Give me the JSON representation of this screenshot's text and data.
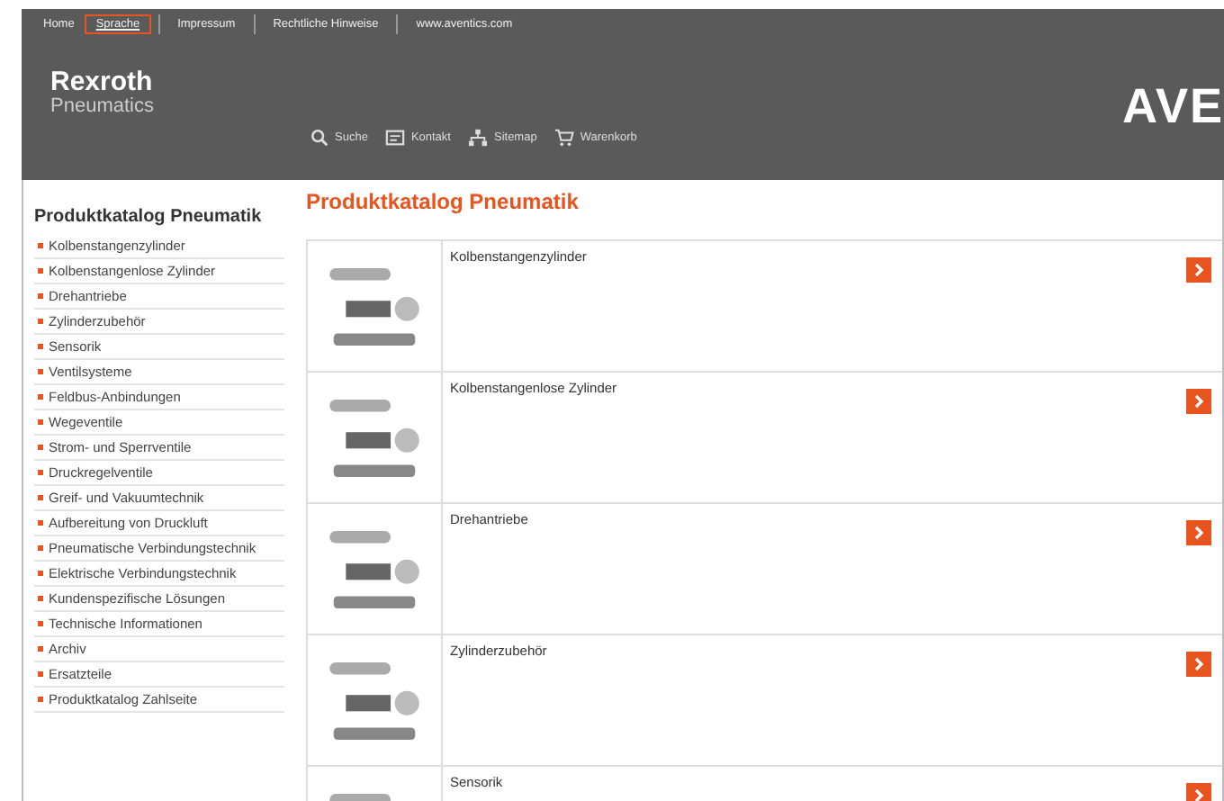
{
  "top_nav": [
    {
      "label": "Home",
      "selected": false
    },
    {
      "label": "Sprache",
      "selected": true
    },
    {
      "label": "Impressum",
      "selected": false
    },
    {
      "label": "Rechtliche Hinweise",
      "selected": false
    },
    {
      "label": "www.aventics.com",
      "selected": false
    }
  ],
  "brand": {
    "name": "Rexroth",
    "subtitle": "Pneumatics",
    "logo_partial": "AVE"
  },
  "tools": [
    {
      "kind": "search",
      "label": "Suche"
    },
    {
      "kind": "contact",
      "label": "Kontakt"
    },
    {
      "kind": "sitemap",
      "label": "Sitemap"
    },
    {
      "kind": "cart",
      "label": "Warenkorb"
    }
  ],
  "sidebar": {
    "title": "Produktkatalog Pneumatik",
    "items": [
      "Kolbenstangenzylinder",
      "Kolbenstangenlose Zylinder",
      "Drehantriebe",
      "Zylinderzubehör",
      "Sensorik",
      "Ventilsysteme",
      "Feldbus-Anbindungen",
      "Wegeventile",
      "Strom- und Sperrventile",
      "Druckregelventile",
      "Greif- und Vakuumtechnik",
      "Aufbereitung von Druckluft",
      "Pneumatische Verbindungstechnik",
      "Elektrische Verbindungstechnik",
      "Kundenspezifische Lösungen",
      "Technische Informationen",
      "Archiv",
      "Ersatzteile",
      "Produktkatalog Zahlseite"
    ]
  },
  "main": {
    "title": "Produktkatalog Pneumatik",
    "products": [
      "Kolbenstangenzylinder",
      "Kolbenstangenlose Zylinder",
      "Drehantriebe",
      "Zylinderzubehör",
      "Sensorik"
    ]
  }
}
